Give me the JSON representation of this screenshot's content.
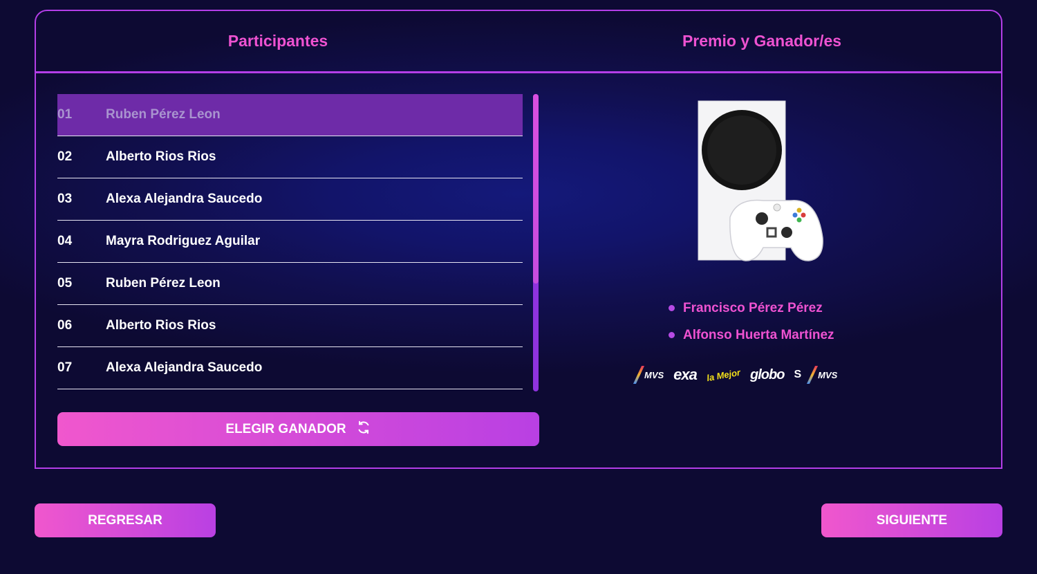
{
  "panel": {
    "participants_title": "Participantes",
    "prize_title": "Premio y Ganador/es"
  },
  "participants": [
    {
      "num": "01",
      "name": "Ruben Pérez Leon",
      "selected": true
    },
    {
      "num": "02",
      "name": "Alberto Rios Rios"
    },
    {
      "num": "03",
      "name": "Alexa Alejandra Saucedo"
    },
    {
      "num": "04",
      "name": "Mayra Rodriguez Aguilar"
    },
    {
      "num": "05",
      "name": "Ruben Pérez Leon"
    },
    {
      "num": "06",
      "name": "Alberto Rios Rios"
    },
    {
      "num": "07",
      "name": "Alexa Alejandra Saucedo"
    }
  ],
  "actions": {
    "choose_winner_label": "ELEGIR GANADOR",
    "back_label": "REGRESAR",
    "next_label": "SIGUIENTE"
  },
  "prize": {
    "image_icon": "xbox-series-s-console-image"
  },
  "winners": [
    "Francisco Pérez Pérez",
    "Alfonso Huerta Martínez"
  ],
  "logos": {
    "mvs_capital": "MVS",
    "exa": "exa",
    "la_mejor": "la Mejor",
    "globo": "globo",
    "stereorey": "S",
    "mvs_radio": "MVS"
  },
  "colors": {
    "accent_pink": "#ee52d1",
    "accent_purple": "#b43ee8",
    "selected_row": "#6e2ba8",
    "background": "#110f4e"
  }
}
